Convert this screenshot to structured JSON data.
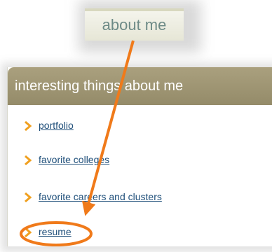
{
  "tab": {
    "label": "about me"
  },
  "panel": {
    "title": "interesting things about me",
    "items": [
      {
        "label": "portfolio",
        "icon": "chevron-right-icon"
      },
      {
        "label": "favorite colleges",
        "icon": "chevron-right-icon"
      },
      {
        "label": "favorite careers and clusters",
        "icon": "chevron-right-icon"
      },
      {
        "label": "resume",
        "icon": "chevron-right-icon"
      }
    ]
  },
  "colors": {
    "accent_orange": "#f07a1a",
    "panel_header": "#9e9573",
    "link": "#1f4f7a",
    "tab_text": "#6d8a86"
  }
}
